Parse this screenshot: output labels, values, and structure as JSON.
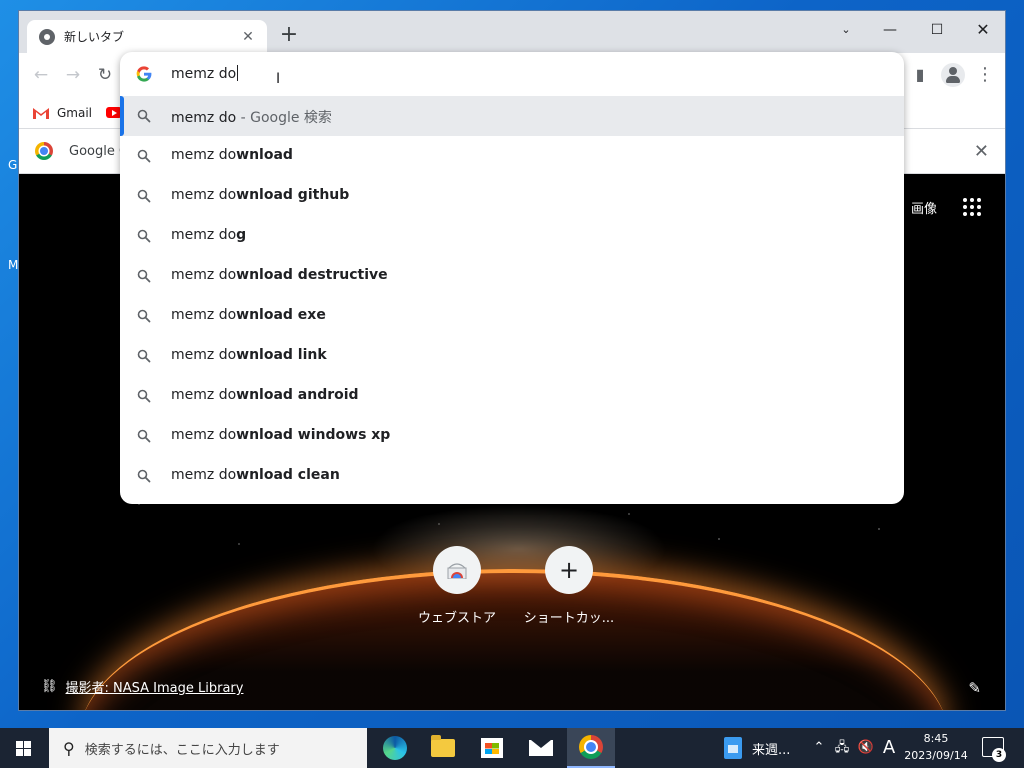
{
  "browser": {
    "tab_title": "新しいタブ",
    "bookmarks": [
      {
        "label": "Gmail"
      }
    ],
    "infobar": {
      "text": "Google C"
    }
  },
  "omnibox": {
    "input_value": "memz do",
    "suggestions": [
      {
        "typed": "memz do",
        "completion": "",
        "description": " - Google 検索",
        "selected": true
      },
      {
        "typed": "memz do",
        "completion": "wnload"
      },
      {
        "typed": "memz do",
        "completion": "wnload github"
      },
      {
        "typed": "memz do",
        "completion": "g"
      },
      {
        "typed": "memz do",
        "completion": "wnload destructive"
      },
      {
        "typed": "memz do",
        "completion": "wnload exe"
      },
      {
        "typed": "memz do",
        "completion": "wnload link"
      },
      {
        "typed": "memz do",
        "completion": "wnload android"
      },
      {
        "typed": "memz do",
        "completion": "wnload windows xp"
      },
      {
        "typed": "memz do",
        "completion": "wnload clean"
      }
    ]
  },
  "ntp": {
    "images_link": "画像",
    "shortcuts": [
      {
        "label": "ウェブストア"
      },
      {
        "label": "ショートカッ..."
      }
    ],
    "credit_text": "撮影者: NASA Image Library"
  },
  "taskbar": {
    "search_placeholder": "検索するには、ここに入力します",
    "weather_text": "来週...",
    "ime_label": "A",
    "time": "8:45",
    "date": "2023/09/14",
    "notification_count": "3"
  },
  "colors": {
    "accent": "#1a73e8",
    "selected_row": "#e8eaed",
    "taskbar": "#1b2433"
  }
}
